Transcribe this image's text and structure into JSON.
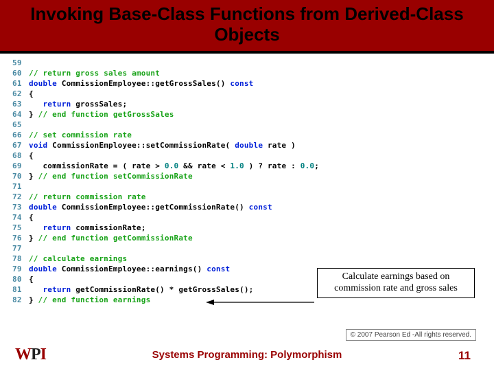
{
  "title": "Invoking Base-Class Functions from Derived-Class Objects",
  "callout": "Calculate earnings based on commission rate and gross sales",
  "copyright": "© 2007 Pearson Ed -All rights reserved.",
  "footer": {
    "logo_w": "W",
    "logo_p": "P",
    "logo_i": "I",
    "center": "Systems Programming:  Polymorphism",
    "page": "11"
  },
  "code": [
    {
      "ln": "59",
      "seg": []
    },
    {
      "ln": "60",
      "seg": [
        {
          "c": "cm",
          "t": "// return gross sales amount"
        }
      ]
    },
    {
      "ln": "61",
      "seg": [
        {
          "c": "kw",
          "t": "double"
        },
        {
          "c": "pl",
          "t": " CommissionEmployee::getGrossSales() "
        },
        {
          "c": "kw",
          "t": "const"
        }
      ]
    },
    {
      "ln": "62",
      "seg": [
        {
          "c": "pl",
          "t": "{"
        }
      ]
    },
    {
      "ln": "63",
      "seg": [
        {
          "c": "pl",
          "t": "   "
        },
        {
          "c": "kw",
          "t": "return"
        },
        {
          "c": "pl",
          "t": " grossSales;"
        }
      ]
    },
    {
      "ln": "64",
      "seg": [
        {
          "c": "pl",
          "t": "} "
        },
        {
          "c": "cm",
          "t": "// end function getGrossSales"
        }
      ]
    },
    {
      "ln": "65",
      "seg": []
    },
    {
      "ln": "66",
      "seg": [
        {
          "c": "cm",
          "t": "// set commission rate"
        }
      ]
    },
    {
      "ln": "67",
      "seg": [
        {
          "c": "kw",
          "t": "void"
        },
        {
          "c": "pl",
          "t": " CommissionEmployee::setCommissionRate( "
        },
        {
          "c": "kw",
          "t": "double"
        },
        {
          "c": "pl",
          "t": " rate )"
        }
      ]
    },
    {
      "ln": "68",
      "seg": [
        {
          "c": "pl",
          "t": "{"
        }
      ]
    },
    {
      "ln": "69",
      "seg": [
        {
          "c": "pl",
          "t": "   commissionRate = ( rate > "
        },
        {
          "c": "nm",
          "t": "0.0"
        },
        {
          "c": "pl",
          "t": " && rate < "
        },
        {
          "c": "nm",
          "t": "1.0"
        },
        {
          "c": "pl",
          "t": " ) ? rate : "
        },
        {
          "c": "nm",
          "t": "0.0"
        },
        {
          "c": "pl",
          "t": ";"
        }
      ]
    },
    {
      "ln": "70",
      "seg": [
        {
          "c": "pl",
          "t": "} "
        },
        {
          "c": "cm",
          "t": "// end function setCommissionRate"
        }
      ]
    },
    {
      "ln": "71",
      "seg": []
    },
    {
      "ln": "72",
      "seg": [
        {
          "c": "cm",
          "t": "// return commission rate"
        }
      ]
    },
    {
      "ln": "73",
      "seg": [
        {
          "c": "kw",
          "t": "double"
        },
        {
          "c": "pl",
          "t": " CommissionEmployee::getCommissionRate() "
        },
        {
          "c": "kw",
          "t": "const"
        }
      ]
    },
    {
      "ln": "74",
      "seg": [
        {
          "c": "pl",
          "t": "{"
        }
      ]
    },
    {
      "ln": "75",
      "seg": [
        {
          "c": "pl",
          "t": "   "
        },
        {
          "c": "kw",
          "t": "return"
        },
        {
          "c": "pl",
          "t": " commissionRate;"
        }
      ]
    },
    {
      "ln": "76",
      "seg": [
        {
          "c": "pl",
          "t": "} "
        },
        {
          "c": "cm",
          "t": "// end function getCommissionRate"
        }
      ]
    },
    {
      "ln": "77",
      "seg": []
    },
    {
      "ln": "78",
      "seg": [
        {
          "c": "cm",
          "t": "// calculate earnings"
        }
      ]
    },
    {
      "ln": "79",
      "seg": [
        {
          "c": "kw",
          "t": "double"
        },
        {
          "c": "pl",
          "t": " CommissionEmployee::earnings() "
        },
        {
          "c": "kw",
          "t": "const"
        }
      ]
    },
    {
      "ln": "80",
      "seg": [
        {
          "c": "pl",
          "t": "{"
        }
      ]
    },
    {
      "ln": "81",
      "seg": [
        {
          "c": "pl",
          "t": "   "
        },
        {
          "c": "kw",
          "t": "return"
        },
        {
          "c": "pl",
          "t": " getCommissionRate() * getGrossSales();"
        }
      ]
    },
    {
      "ln": "82",
      "seg": [
        {
          "c": "pl",
          "t": "} "
        },
        {
          "c": "cm",
          "t": "// end function earnings"
        }
      ]
    }
  ]
}
